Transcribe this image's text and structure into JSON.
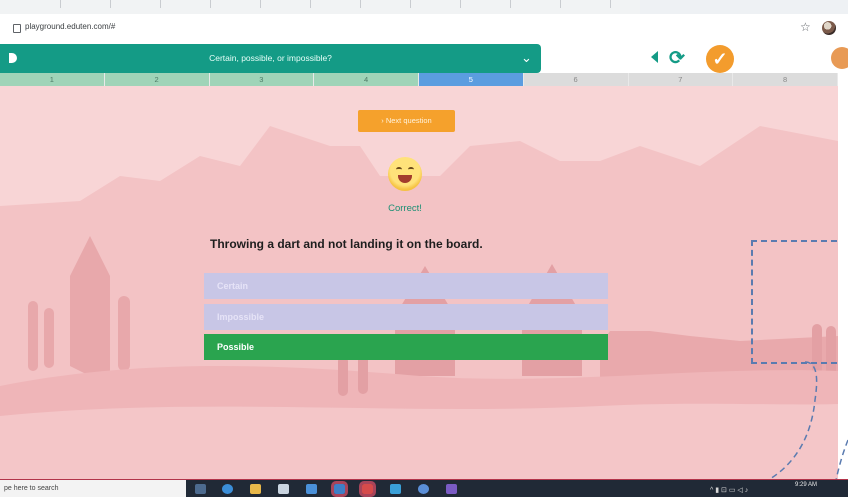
{
  "browser": {
    "url": "playground.eduten.com/#",
    "bookmark_icon": "star-icon",
    "profile_icon": "profile-avatar-icon"
  },
  "header": {
    "title": "Certain, possible, or impossible?",
    "dropdown_icon": "chevron-down-icon",
    "back_icon": "back-triangle-icon",
    "refresh_icon": "refresh-icon",
    "check_icon": "check-icon"
  },
  "progress": {
    "segments": [
      {
        "label": "1",
        "state": "done"
      },
      {
        "label": "2",
        "state": "done"
      },
      {
        "label": "3",
        "state": "done"
      },
      {
        "label": "4",
        "state": "done"
      },
      {
        "label": "5",
        "state": "active"
      },
      {
        "label": "6",
        "state": "todo"
      },
      {
        "label": "7",
        "state": "todo"
      },
      {
        "label": "8",
        "state": "todo"
      }
    ]
  },
  "exercise": {
    "next_button": "› Next question",
    "feedback": "Correct!",
    "question": "Throwing a dart and not landing it on the board.",
    "options": [
      {
        "label": "Certain",
        "state": "dim"
      },
      {
        "label": "Impossible",
        "state": "dim"
      },
      {
        "label": "Possible",
        "state": "selected"
      }
    ]
  },
  "taskbar": {
    "search_placeholder": "pe here to search",
    "clock_time": "9:29 AM",
    "clock_date": ""
  },
  "colors": {
    "teal": "#149b86",
    "orange": "#f5a12c",
    "stage_pink": "#f8d5d6",
    "correct_green": "#2aa44f",
    "dim_option": "#c8c6e6"
  }
}
